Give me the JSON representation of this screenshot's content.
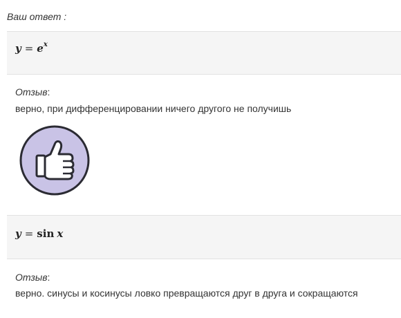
{
  "header": {
    "label": "Ваш ответ :"
  },
  "answers": [
    {
      "formula": {
        "lhs": "y",
        "op": "=",
        "base": "e",
        "exp": "x"
      },
      "feedback_title": "Отзыв",
      "feedback_colon": ":",
      "feedback_text": "верно, при дифференцировании ничего другого не получишь",
      "icon": "thumbs-up-icon"
    },
    {
      "formula": {
        "lhs": "y",
        "op": "=",
        "fn": "sin",
        "arg": "x"
      },
      "feedback_title": "Отзыв",
      "feedback_colon": ":",
      "feedback_text": "верно. синусы и косинусы ловко превращаются друг в друга и сокращаются"
    }
  ],
  "colors": {
    "answer_bg": "#f5f5f5",
    "thumb_circle": "#c9c3e6",
    "thumb_stroke": "#2b2b33"
  }
}
